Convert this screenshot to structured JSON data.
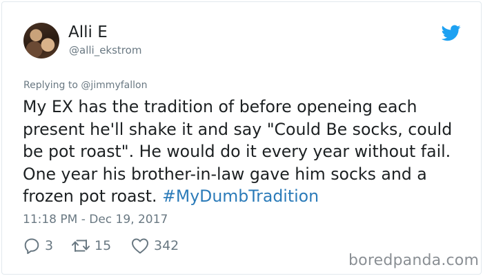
{
  "author": {
    "name": "Alli E",
    "handle": "@alli_ekstrom"
  },
  "reply": {
    "prefix": "Replying to",
    "mention": "@jimmyfallon"
  },
  "tweet": {
    "text": "My EX has the tradition of before openeing each present he'll shake it and say \"Could Be socks, could be pot roast\". He would do it every year without fail. One year his brother-in-law gave him socks and a frozen pot roast.",
    "hashtag": "#MyDumbTradition",
    "timestamp": "11:18 PM - Dec 19, 2017"
  },
  "actions": {
    "replies": "3",
    "retweets": "15",
    "likes": "342"
  },
  "watermark": "boredpanda.com",
  "colors": {
    "text": "#1c2022",
    "secondary": "#697882",
    "link": "#2b7bb9",
    "twitter_blue": "#1da1f2"
  },
  "icons": [
    "avatar",
    "twitter-bird-icon",
    "reply-icon",
    "retweet-icon",
    "heart-icon"
  ]
}
